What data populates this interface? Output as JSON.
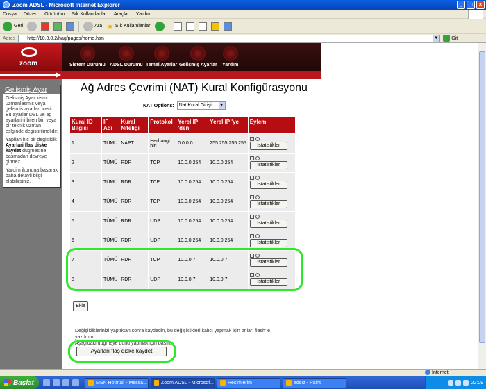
{
  "window": {
    "title": "Zoom ADSL - Microsoft Internet Explorer"
  },
  "menu": [
    "Dosya",
    "Düzen",
    "Görünüm",
    "Sık Kullanılanlar",
    "Araçlar",
    "Yardım"
  ],
  "toolbar": {
    "back": "Geri",
    "search": "Ara",
    "favorites": "Sık Kullanılanlar"
  },
  "address": {
    "label": "Adres",
    "url": "http://10.0.0.2/hag/pages/home.htm",
    "go": "Git"
  },
  "header": {
    "logo": "zoom",
    "nav": [
      {
        "label": "Sistem Durumu",
        "icon": "system-status-icon"
      },
      {
        "label": "ADSL Durumu",
        "icon": "adsl-status-icon"
      },
      {
        "label": "Temel Ayarlar",
        "icon": "basic-settings-icon"
      },
      {
        "label": "Gelişmiş Ayarlar",
        "icon": "advanced-settings-icon"
      },
      {
        "label": "Yardım",
        "icon": "help-icon"
      }
    ]
  },
  "sidebar": {
    "title": "Gelismiş Ayar",
    "p1": "Gelismiş Ayar kismi uzmanlasmis veya gelismis ayarlari icerir. Bu ayarlar DSL ve ag ayarlarini bilen biri veya bir teknik uzman eslginde degistirilmelidir.",
    "p2_pre": "Yapilan hic bir degisiklik ",
    "p2_bold": "Ayarlari flas diske kaydet",
    "p2_post": " dugmesine basmadan devreye girmez.",
    "p3": "Yardim ikonuna basarak daha detayli bilgi alabilirsiniz."
  },
  "main": {
    "title": "Ağ Adres Çevrimi (NAT) Kural Konfigürasyonu",
    "nat_options_label": "NAT Options:",
    "nat_options_value": "Nat Kural Girişi",
    "columns": [
      "Kural ID Bilgisi",
      "IF Adı",
      "Kural Niteliği",
      "Protokol",
      "Yerel IP 'den",
      "Yerel IP 'ye",
      "Eylem"
    ],
    "stats_label": "İstatistikler",
    "rows": [
      {
        "id": "1",
        "if": "TÜMÜ",
        "type": "NAPT",
        "proto": "Herhangi biri",
        "from": "0.0.0.0",
        "to": "255.255.255.255"
      },
      {
        "id": "2",
        "if": "TÜMÜ",
        "type": "RDR",
        "proto": "TCP",
        "from": "10.0.0.254",
        "to": "10.0.0.254"
      },
      {
        "id": "3",
        "if": "TÜMÜ",
        "type": "RDR",
        "proto": "TCP",
        "from": "10.0.0.254",
        "to": "10.0.0.254"
      },
      {
        "id": "4",
        "if": "TÜMÜ",
        "type": "RDR",
        "proto": "TCP",
        "from": "10.0.0.254",
        "to": "10.0.0.254"
      },
      {
        "id": "5",
        "if": "TÜMÜ",
        "type": "RDR",
        "proto": "UDP",
        "from": "10.0.0.254",
        "to": "10.0.0.254"
      },
      {
        "id": "6",
        "if": "TÜMÜ",
        "type": "RDR",
        "proto": "UDP",
        "from": "10.0.0.254",
        "to": "10.0.0.254"
      },
      {
        "id": "7",
        "if": "TÜMÜ",
        "type": "RDR",
        "proto": "TCP",
        "from": "10.0.0.7",
        "to": "10.0.0.7"
      },
      {
        "id": "8",
        "if": "TÜMÜ",
        "type": "RDR",
        "proto": "UDP",
        "from": "10.0.0.7",
        "to": "10.0.0.7"
      }
    ],
    "add_button": "Ekle",
    "note_line1": "Değişikliklerinizi yaptıktan sonra kaydedin, bu değişiklikleri kalıcı yapmak için onları flash' e yazdının.",
    "note_line2": "Aşağıdaki düğmeye bunu yapmak için basın.",
    "save_button": "Ayarları flaş diske kaydet"
  },
  "status": {
    "zone": "Internet"
  },
  "taskbar": {
    "start": "Başlat",
    "tasks": [
      "MSN Hotmail - Messa...",
      "Zoom ADSL - Microsof...",
      "Resimlerim",
      "adsız - Paint"
    ],
    "clock": "22:09"
  },
  "colors": {
    "header_red": "#b50d11",
    "highlight_green": "#2ee82a",
    "sidebar_grey": "#777777"
  }
}
